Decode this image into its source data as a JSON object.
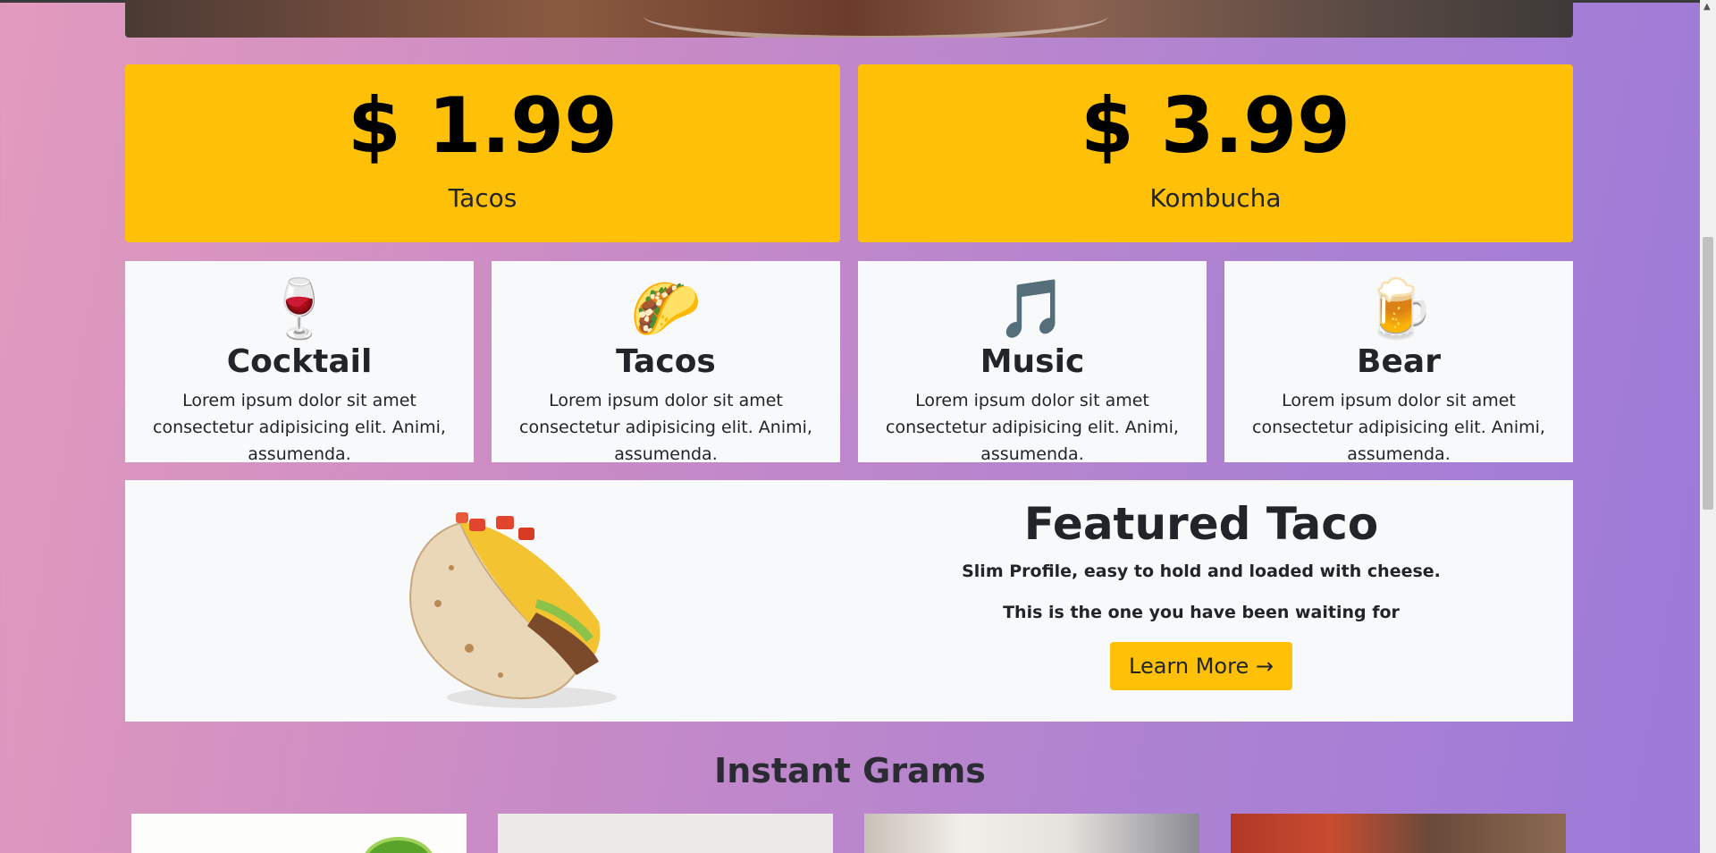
{
  "prices": [
    {
      "amount": "$ 1.99",
      "label": "Tacos"
    },
    {
      "amount": "$ 3.99",
      "label": "Kombucha"
    }
  ],
  "features": [
    {
      "emoji": "🍷",
      "icon": "wine-glass-icon",
      "title": "Cocktail",
      "text": "Lorem ipsum dolor sit amet consectetur adipisicing elit. Animi, assumenda."
    },
    {
      "emoji": "🌮",
      "icon": "taco-icon",
      "title": "Tacos",
      "text": "Lorem ipsum dolor sit amet consectetur adipisicing elit. Animi, assumenda."
    },
    {
      "emoji": "🎵",
      "icon": "music-note-icon",
      "title": "Music",
      "text": "Lorem ipsum dolor sit amet consectetur adipisicing elit. Animi, assumenda."
    },
    {
      "emoji": "🍺",
      "icon": "beer-mug-icon",
      "title": "Bear",
      "text": "Lorem ipsum dolor sit amet consectetur adipisicing elit. Animi, assumenda."
    }
  ],
  "featured": {
    "title": "Featured Taco",
    "line1": "Slim Profile, easy to hold and loaded with cheese.",
    "line2": "This is the one you have been waiting for",
    "button": "Learn More →"
  },
  "grams": {
    "title": "Instant Grams"
  },
  "colors": {
    "accent": "#ffc107",
    "card": "#f8f9fa",
    "text": "#212529"
  }
}
